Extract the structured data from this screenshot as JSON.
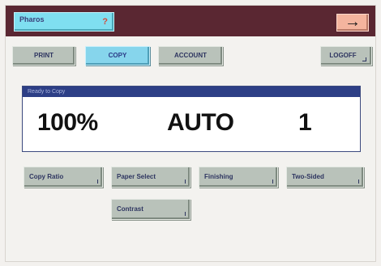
{
  "header": {
    "app_name": "Pharos",
    "app_mark": "?",
    "arrow_glyph": "→"
  },
  "tabs": [
    {
      "label": "PRINT",
      "active": false
    },
    {
      "label": "COPY",
      "active": true
    },
    {
      "label": "ACCOUNT",
      "active": false
    }
  ],
  "logoff_label": "LOGOFF",
  "status": {
    "message": "Ready to Copy",
    "ratio": "100%",
    "paper": "AUTO",
    "copies": "1"
  },
  "functions": [
    {
      "label": "Copy Ratio"
    },
    {
      "label": "Paper Select"
    },
    {
      "label": "Finishing"
    },
    {
      "label": "Two-Sided"
    },
    {
      "label": "Contrast"
    }
  ],
  "colors": {
    "header_bg": "#5a2732",
    "app_badge": "#7fdff0",
    "arrow_button": "#f4b49e",
    "active_tab": "#86d5ec",
    "button_gray": "#b9c2ba",
    "status_bar": "#2d3f86"
  }
}
